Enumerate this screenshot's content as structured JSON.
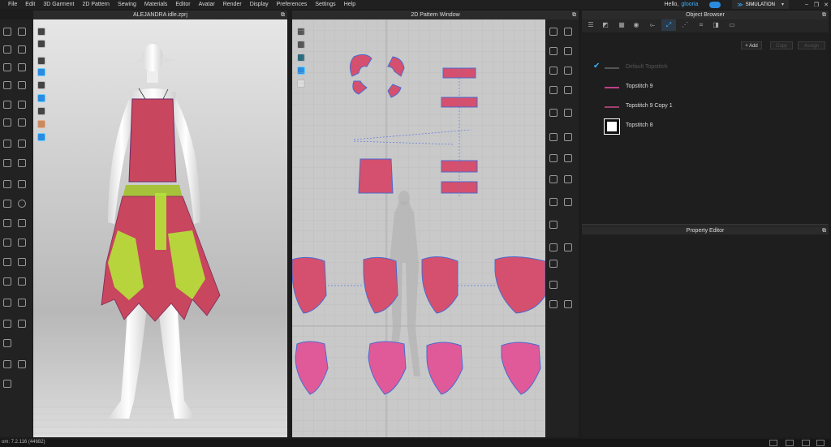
{
  "menu": [
    "File",
    "Edit",
    "3D Garment",
    "2D Pattern",
    "Sewing",
    "Materials",
    "Editor",
    "Avatar",
    "Render",
    "Display",
    "Preferences",
    "Settings",
    "Help"
  ],
  "user": {
    "greeting": "Hello,",
    "name": "glooria",
    "mode": "SIMULATION"
  },
  "view3d": {
    "title": "ALEJANDRA idle.zprj"
  },
  "view2d": {
    "title": "2D Pattern Window"
  },
  "object_browser": {
    "title": "Object Browser",
    "add_label": "+ Add",
    "copy_label": "Copy",
    "assign_label": "Assign",
    "items": [
      {
        "label": "Default Topstitch",
        "color": "#555555",
        "active": true
      },
      {
        "label": "Topstitch 9",
        "color": "#c0408a",
        "active": false
      },
      {
        "label": "Topstitch 9 Copy 1",
        "color": "#a04070",
        "active": false
      },
      {
        "label": "Topstitch 8",
        "color": "#ffffff",
        "active": false
      }
    ]
  },
  "property_editor": {
    "title": "Property Editor"
  },
  "status": {
    "text": "om: 7.2.116 (44682)"
  },
  "colors": {
    "accent": "#2a8be0",
    "fabric": "#d4506e",
    "fabric_green": "#b5e33a"
  }
}
